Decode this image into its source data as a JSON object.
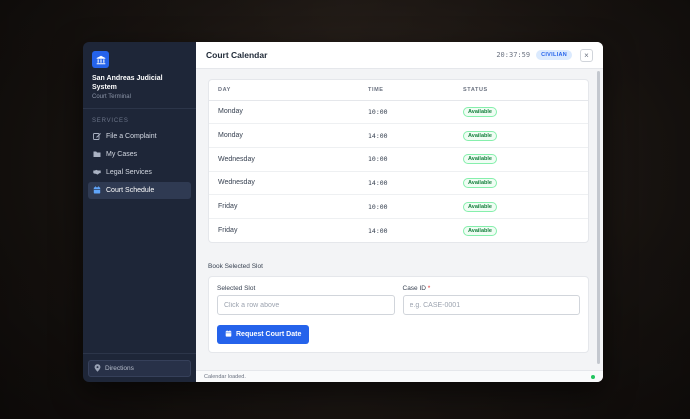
{
  "sidebar": {
    "brand_name": "San Andreas Judicial System",
    "brand_sub": "Court Terminal",
    "section_label": "SERVICES",
    "items": [
      {
        "label": "File a Complaint",
        "icon": "edit-icon",
        "active": false
      },
      {
        "label": "My Cases",
        "icon": "folder-icon",
        "active": false
      },
      {
        "label": "Legal Services",
        "icon": "handshake-icon",
        "active": false
      },
      {
        "label": "Court Schedule",
        "icon": "calendar-icon",
        "active": true
      }
    ],
    "directions_label": "Directions"
  },
  "header": {
    "title": "Court Calendar",
    "clock": "20:37:59",
    "role": "CIVILIAN",
    "close_label": "×"
  },
  "calendar": {
    "columns": [
      "DAY",
      "TIME",
      "STATUS"
    ],
    "rows": [
      {
        "day": "Monday",
        "time": "10:00",
        "status": "Available"
      },
      {
        "day": "Monday",
        "time": "14:00",
        "status": "Available"
      },
      {
        "day": "Wednesday",
        "time": "10:00",
        "status": "Available"
      },
      {
        "day": "Wednesday",
        "time": "14:00",
        "status": "Available"
      },
      {
        "day": "Friday",
        "time": "10:00",
        "status": "Available"
      },
      {
        "day": "Friday",
        "time": "14:00",
        "status": "Available"
      }
    ]
  },
  "booking": {
    "section_title": "Book Selected Slot",
    "slot_label": "Selected Slot",
    "slot_placeholder": "Click a row above",
    "case_label": "Case ID",
    "case_required_mark": "*",
    "case_placeholder": "e.g. CASE-0001",
    "submit_label": "Request Court Date"
  },
  "statusbar": {
    "text": "Calendar loaded."
  },
  "colors": {
    "accent": "#2563eb",
    "sidebar_bg": "#1e2638",
    "available": "#15803d",
    "online_dot": "#22c55e"
  }
}
